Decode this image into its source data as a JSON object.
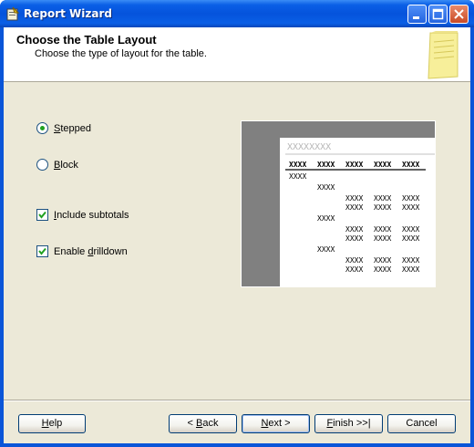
{
  "window": {
    "title": "Report Wizard",
    "icon": "report-wizard-icon"
  },
  "header": {
    "title": "Choose the Table Layout",
    "subtitle": "Choose the type of layout for the table.",
    "icon": "notepad-icon"
  },
  "layout_options": [
    {
      "label": "Stepped",
      "mnemonic": "S",
      "checked": true
    },
    {
      "label": "Block",
      "mnemonic": "B",
      "checked": false
    }
  ],
  "checkboxes": [
    {
      "label": "Include subtotals",
      "mnemonic": "I",
      "checked": true
    },
    {
      "label": "Enable drilldown",
      "mnemonic": "d",
      "checked": true
    }
  ],
  "preview": {
    "title": "XXXXXXXX",
    "header_row": [
      "XXXX",
      "XXXX",
      "XXXX",
      "XXXX",
      "XXXX"
    ],
    "cell": "XXXX"
  },
  "buttons": {
    "help": "Help",
    "back": "< Back",
    "next": "Next >",
    "finish": "Finish >>|",
    "cancel": "Cancel"
  },
  "colors": {
    "titlebar": "#0553dc",
    "dialog_bg": "#ece9d8",
    "check_green": "#21a121"
  }
}
